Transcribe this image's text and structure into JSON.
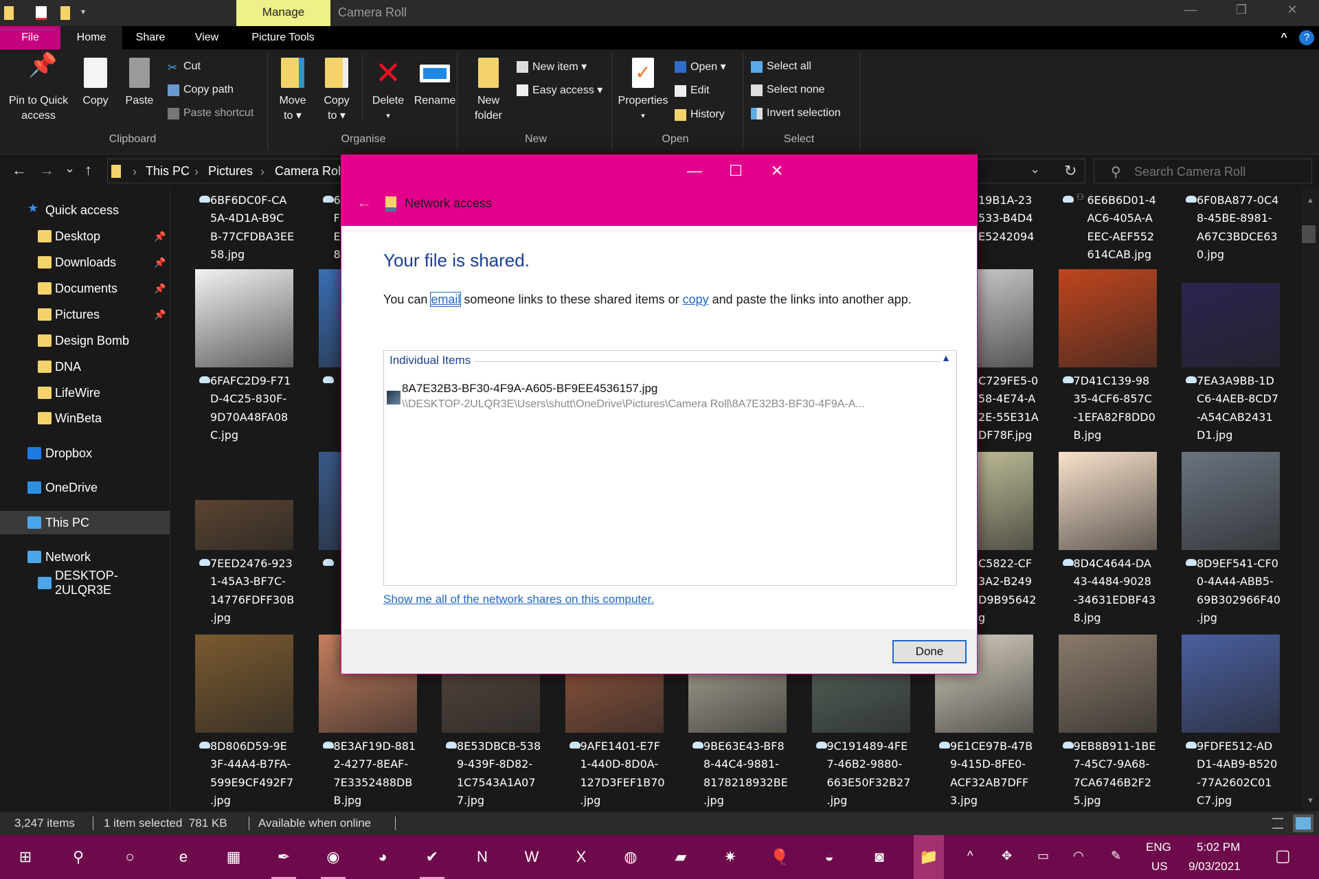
{
  "titlebar": {
    "context_tab": "Manage",
    "title": "Camera Roll",
    "minimize": "—",
    "restore": "❐",
    "close": "✕"
  },
  "ribbon_tabs": {
    "file": "File",
    "home": "Home",
    "share": "Share",
    "view": "View",
    "picture_tools": "Picture Tools",
    "collapse": "^",
    "help": "?"
  },
  "ribbon": {
    "clipboard": {
      "label": "Clipboard",
      "pin": "Pin to Quick access",
      "pin_l1": "Pin to Quick",
      "pin_l2": "access",
      "copy": "Copy",
      "paste": "Paste",
      "cut": "Cut",
      "copy_path": "Copy path",
      "paste_shortcut": "Paste shortcut"
    },
    "organise": {
      "label": "Organise",
      "move_l1": "Move",
      "move_l2": "to ▾",
      "copy_l1": "Copy",
      "copy_l2": "to ▾",
      "delete": "Delete",
      "delete_arrow": "▾",
      "rename": "Rename"
    },
    "new": {
      "label": "New",
      "folder_l1": "New",
      "folder_l2": "folder",
      "new_item": "New item ▾",
      "easy_access": "Easy access ▾"
    },
    "open": {
      "label": "Open",
      "properties": "Properties",
      "properties_arrow": "▾",
      "open": "Open ▾",
      "edit": "Edit",
      "history": "History"
    },
    "select": {
      "label": "Select",
      "select_all": "Select all",
      "select_none": "Select none",
      "invert": "Invert selection"
    }
  },
  "address": {
    "back": "←",
    "forward": "→",
    "recent": "⌄",
    "up": "↑",
    "crumbs": [
      "This PC",
      "Pictures",
      "Camera Roll"
    ],
    "sep": "›",
    "dropdown": "⌄",
    "refresh": "↻",
    "search_placeholder": "Search Camera Roll"
  },
  "sidebar": {
    "items": [
      {
        "label": "Quick access",
        "icon": "star-icon",
        "color": "#3b8eea"
      },
      {
        "label": "Desktop",
        "icon": "desktop-folder-icon",
        "color": "#f5d36b",
        "pinned": true
      },
      {
        "label": "Downloads",
        "icon": "downloads-folder-icon",
        "color": "#f5d36b",
        "pinned": true
      },
      {
        "label": "Documents",
        "icon": "documents-folder-icon",
        "color": "#f5d36b",
        "pinned": true
      },
      {
        "label": "Pictures",
        "icon": "pictures-folder-icon",
        "color": "#f5d36b",
        "pinned": true
      },
      {
        "label": "Design Bomb",
        "icon": "folder-icon",
        "color": "#f5d36b"
      },
      {
        "label": "DNA",
        "icon": "folder-icon",
        "color": "#f5d36b"
      },
      {
        "label": "LifeWire",
        "icon": "folder-icon",
        "color": "#f5d36b"
      },
      {
        "label": "WinBeta",
        "icon": "folder-icon",
        "color": "#f5d36b"
      },
      {
        "label": "Dropbox",
        "icon": "dropbox-icon",
        "color": "#1e7ae0"
      },
      {
        "label": "OneDrive",
        "icon": "onedrive-icon",
        "color": "#2e8ee0"
      },
      {
        "label": "This PC",
        "icon": "pc-icon",
        "color": "#4aa6e8",
        "selected": true
      },
      {
        "label": "Network",
        "icon": "network-icon",
        "color": "#4aa6e8"
      },
      {
        "label": "DESKTOP-2ULQR3E",
        "icon": "computer-icon",
        "color": "#4aa6e8"
      }
    ],
    "pin_glyph": "📌"
  },
  "files": {
    "rows": [
      [
        {
          "lines": [
            "6BF6DC0F-CA",
            "5A-4D1A-B9C",
            "B-77CFDBA3EE",
            "58.jpg"
          ],
          "cloud": true
        },
        {
          "lines": [
            "6",
            "F",
            "E",
            "8"
          ],
          "cloud": true
        },
        null,
        null,
        null,
        null,
        {
          "lines": [
            "19B1A-23",
            "533-B4D4",
            "E5242094"
          ],
          "cloud": false
        },
        {
          "lines": [
            "6E6B6D01-4",
            "AC6-405A-A",
            "EEC-AEF552",
            "614CAB.jpg"
          ],
          "cloud": true,
          "shared": true
        },
        {
          "lines": [
            "6F0BA877-0C4",
            "8-45BE-8981-",
            "A67C3BDCE63",
            "0.jpg"
          ],
          "cloud": true
        }
      ],
      [
        {
          "lines": [
            "6FAFC2D9-F71",
            "D-4C25-830F-",
            "9D70A48FA08",
            "C.jpg"
          ],
          "cloud": true,
          "thumb": "#f2f2f2"
        },
        {
          "lines": [],
          "cloud": true,
          "thumb": "#3b6fb5"
        },
        null,
        null,
        null,
        null,
        {
          "lines": [
            "C729FE5-0",
            "58-4E74-A",
            "2E-55E31A",
            "DF78F.jpg"
          ],
          "cloud": false,
          "thumb": "#d4d4d4"
        },
        {
          "lines": [
            "7D41C139-98",
            "35-4CF6-857C",
            "-1EFA82F8DD0",
            "B.jpg"
          ],
          "cloud": true,
          "thumb": "#c0451e"
        },
        {
          "lines": [
            "7EA3A9BB-1D",
            "C6-4AEB-8CD7",
            "-A54CAB2431",
            "D1.jpg"
          ],
          "cloud": true,
          "thumb": "#2a2550"
        }
      ],
      [
        {
          "lines": [
            "7EED2476-923",
            "1-45A3-BF7C-",
            "14776FDFF30B",
            ".jpg"
          ],
          "cloud": true,
          "thumb": "#5a4430"
        },
        {
          "lines": [],
          "cloud": true,
          "thumb": "#3a5a8a"
        },
        null,
        null,
        null,
        null,
        {
          "lines": [
            "C5822-CF",
            "3A2-B249",
            "D9B95642",
            "g"
          ],
          "cloud": false,
          "thumb": "#c9c7a0"
        },
        {
          "lines": [
            "8D4C4644-DA",
            "43-4484-9028",
            "-34631EDBF43",
            "8.jpg"
          ],
          "cloud": true,
          "thumb": "#f9e2cc"
        },
        {
          "lines": [
            "8D9EF541-CF0",
            "0-4A44-ABB5-",
            "69B302966F40",
            ".jpg"
          ],
          "cloud": true,
          "thumb": "#6a7380"
        }
      ],
      [
        {
          "lines": [
            "8D806D59-9E",
            "3F-44A4-B7FA-",
            "599E9CF492F7",
            ".jpg"
          ],
          "cloud": true,
          "thumb": "#7a5a30"
        },
        {
          "lines": [
            "8E3AF19D-881",
            "2-4277-8EAF-",
            "7E3352488DB",
            "B.jpg"
          ],
          "cloud": true,
          "thumb": "#c88060"
        },
        {
          "lines": [
            "8E53DBCB-538",
            "9-439F-8D82-",
            "1C7543A1A07",
            "7.jpg"
          ],
          "cloud": true,
          "thumb": "#5a4a40"
        },
        {
          "lines": [
            "9AFE1401-E7F",
            "1-440D-8D0A-",
            "127D3FEF1B70",
            ".jpg"
          ],
          "cloud": true,
          "thumb": "#9a5a40"
        },
        {
          "lines": [
            "9BE63E43-BF8",
            "8-44C4-9881-",
            "8178218932BE",
            ".jpg"
          ],
          "cloud": true,
          "thumb": "#b8b0a0"
        },
        {
          "lines": [
            "9C191489-4FE",
            "7-46B2-9880-",
            "663E50F32B27",
            ".jpg"
          ],
          "cloud": true,
          "thumb": "#5a6a60"
        },
        {
          "lines": [
            "9E1CE97B-47B",
            "9-415D-8FE0-",
            "ACF32AB7DFF",
            "3.jpg"
          ],
          "cloud": true,
          "thumb": "#d8d0c0"
        },
        {
          "lines": [
            "9EB8B911-1BE",
            "7-45C7-9A68-",
            "7CA6746B2F2",
            "5.jpg"
          ],
          "cloud": true,
          "thumb": "#8a7a6a"
        },
        {
          "lines": [
            "9FDFE512-AD",
            "D1-4AB9-B520",
            "-77A2602C01",
            "C7.jpg"
          ],
          "cloud": true,
          "thumb": "#4a5fa0"
        }
      ]
    ]
  },
  "status": {
    "count": "3,247 items",
    "selection": "1 item selected  781 KB",
    "availability": "Available when online"
  },
  "dialog": {
    "title": "Network access",
    "back": "←",
    "minimize": "—",
    "maximize": "☐",
    "close": "✕",
    "heading": "Your file is shared.",
    "para_1": "You can ",
    "email_link": "email",
    "para_2": " someone links to these shared items or ",
    "copy_link": "copy",
    "para_3": " and paste the links into another app.",
    "group_title": "Individual Items",
    "group_toggle": "▲",
    "item_name": "8A7E32B3-BF30-4F9A-A605-BF9EE4536157.jpg",
    "item_path": "\\\\DESKTOP-2ULQR3E\\Users\\shutt\\OneDrive\\Pictures\\Camera Roll\\8A7E32B3-BF30-4F9A-A...",
    "shares_link": "Show me all of the network shares on this computer.",
    "done": "Done",
    "accent": "#e3008c"
  },
  "taskbar": {
    "apps": [
      {
        "icon": "start-icon",
        "glyph": "⊞"
      },
      {
        "icon": "search-icon",
        "glyph": "⚲"
      },
      {
        "icon": "cortana-icon",
        "glyph": "○"
      },
      {
        "icon": "edge-icon",
        "glyph": "e"
      },
      {
        "icon": "store-icon",
        "glyph": "▦"
      },
      {
        "icon": "feather-app-icon",
        "glyph": "✒",
        "running": true
      },
      {
        "icon": "chrome-icon",
        "glyph": "◉",
        "running": true
      },
      {
        "icon": "firefox-icon",
        "glyph": "◕"
      },
      {
        "icon": "todo-icon",
        "glyph": "✔",
        "running": true
      },
      {
        "icon": "onenote-icon",
        "glyph": "N"
      },
      {
        "icon": "word-icon",
        "glyph": "W"
      },
      {
        "icon": "excel-icon",
        "glyph": "X"
      },
      {
        "icon": "spotify-icon",
        "glyph": "◍"
      },
      {
        "icon": "sticky-notes-icon",
        "glyph": "▰"
      },
      {
        "icon": "star-app-icon",
        "glyph": "✷"
      },
      {
        "icon": "balloon-app-icon",
        "glyph": "🎈"
      },
      {
        "icon": "headphones-app-icon",
        "glyph": "◒"
      },
      {
        "icon": "cd-app-icon",
        "glyph": "◙"
      },
      {
        "icon": "file-explorer-icon",
        "glyph": "📁",
        "active": true
      }
    ],
    "tray": {
      "chevron": "^",
      "dropbox": "✥",
      "battery": "▭",
      "wifi": "◠",
      "pen": "✎",
      "lang1": "ENG",
      "lang2": "US",
      "time": "5:02 PM",
      "date": "9/03/2021",
      "notifications": "▢"
    }
  }
}
